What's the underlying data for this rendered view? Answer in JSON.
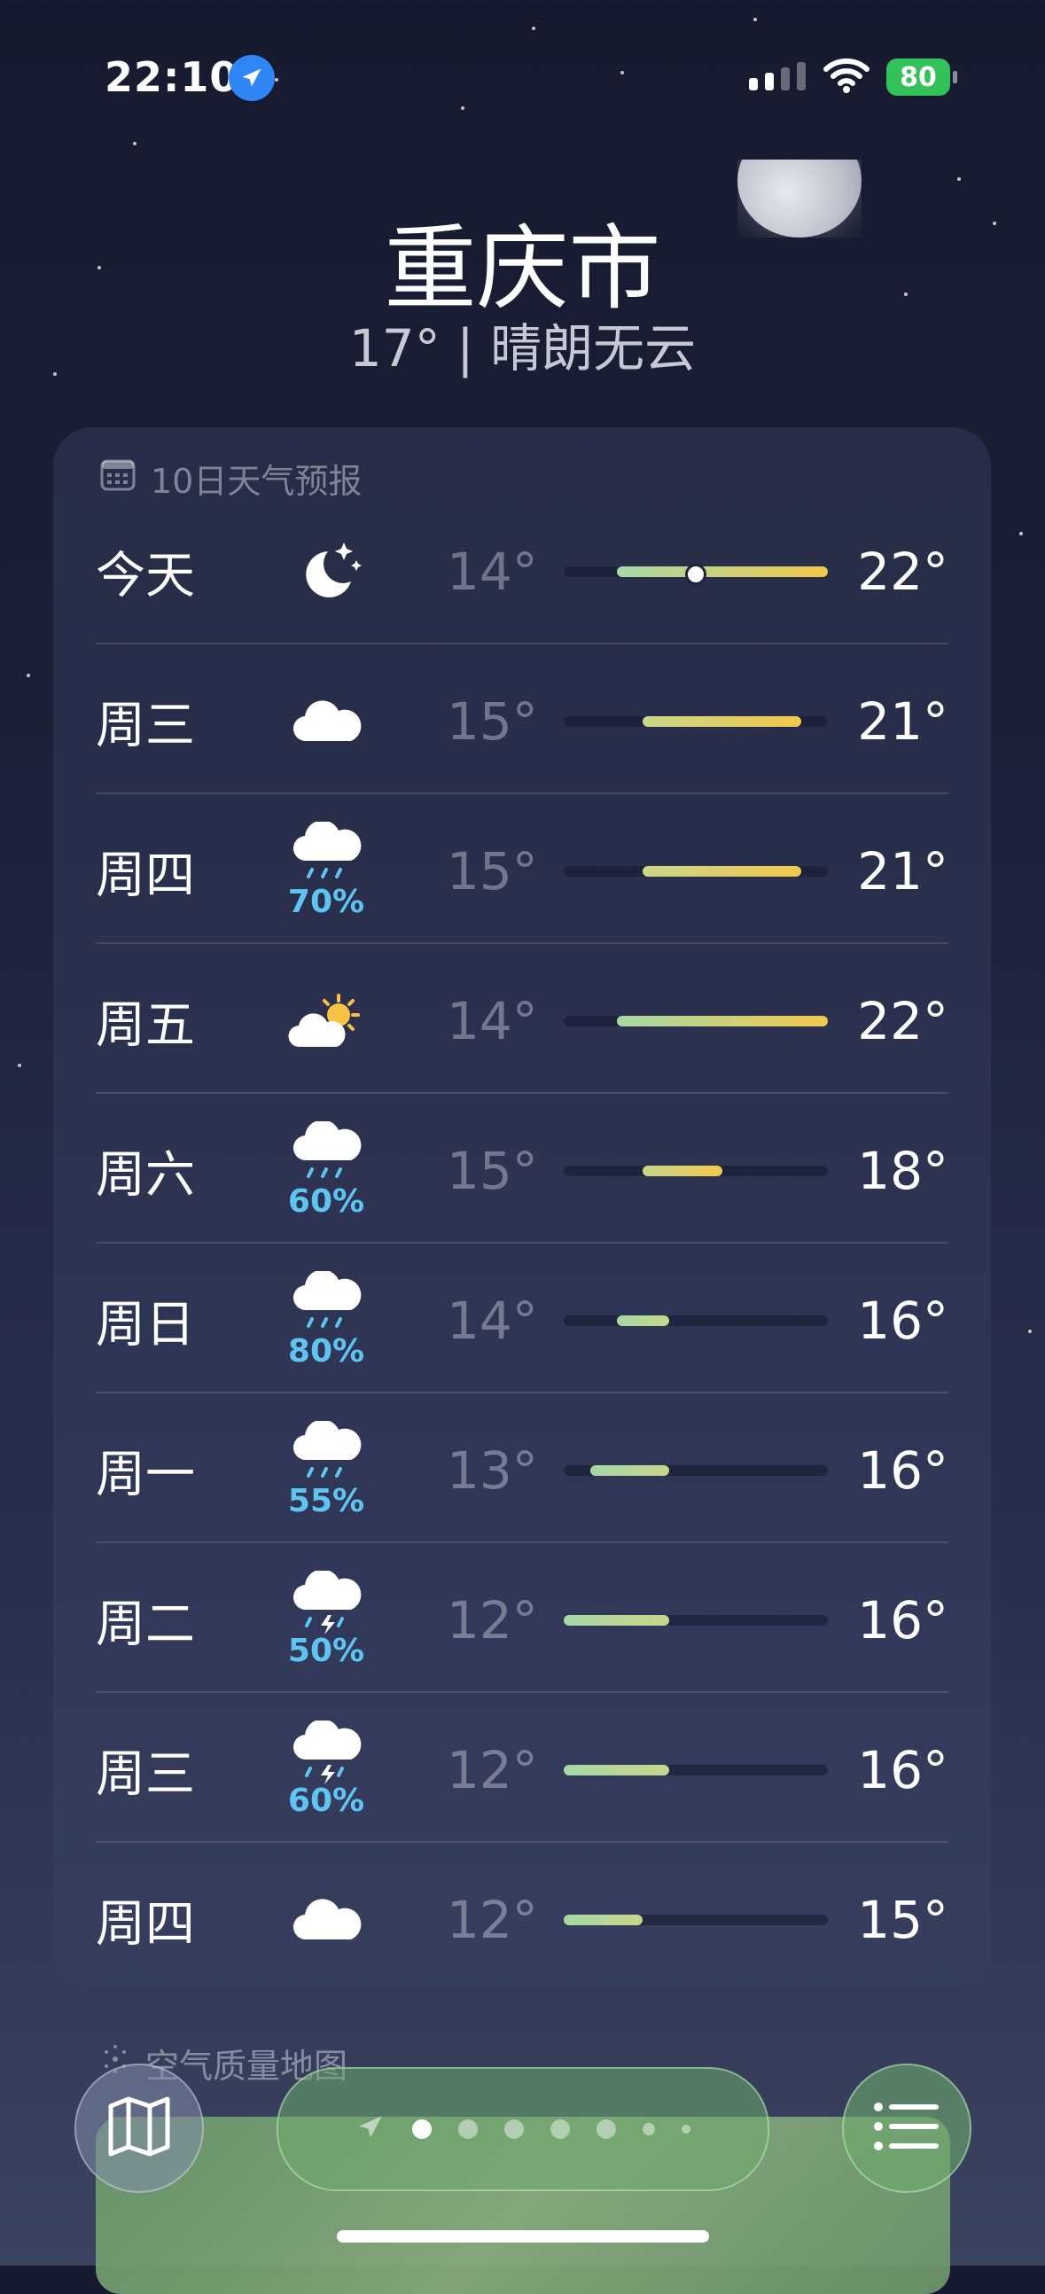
{
  "status_bar": {
    "time": "22:10",
    "battery": "80"
  },
  "location": {
    "city": "重庆市",
    "current": "17° | 晴朗无云"
  },
  "forecast": {
    "title": "10日天气预报",
    "days": [
      {
        "day": "今天",
        "icon": "moon-stars-icon",
        "precip": "",
        "low": "14°",
        "high": "22°",
        "current_marker": true
      },
      {
        "day": "周三",
        "icon": "cloud-icon",
        "precip": "",
        "low": "15°",
        "high": "21°"
      },
      {
        "day": "周四",
        "icon": "cloud-rain-icon",
        "precip": "70%",
        "low": "15°",
        "high": "21°"
      },
      {
        "day": "周五",
        "icon": "cloud-sun-icon",
        "precip": "",
        "low": "14°",
        "high": "22°"
      },
      {
        "day": "周六",
        "icon": "cloud-rain-icon",
        "precip": "60%",
        "low": "15°",
        "high": "18°"
      },
      {
        "day": "周日",
        "icon": "cloud-rain-icon",
        "precip": "80%",
        "low": "14°",
        "high": "16°"
      },
      {
        "day": "周一",
        "icon": "cloud-rain-icon",
        "precip": "55%",
        "low": "13°",
        "high": "16°"
      },
      {
        "day": "周二",
        "icon": "cloud-thunder-icon",
        "precip": "50%",
        "low": "12°",
        "high": "16°"
      },
      {
        "day": "周三",
        "icon": "cloud-thunder-icon",
        "precip": "60%",
        "low": "12°",
        "high": "16°"
      },
      {
        "day": "周四",
        "icon": "cloud-icon",
        "precip": "",
        "low": "12°",
        "high": "15°"
      }
    ],
    "range_min": 12,
    "range_max": 22,
    "current_temp": 17
  },
  "air_quality": {
    "title": "空气质量地图"
  },
  "colors": {
    "cool": "#a6d8a8",
    "mild": "#c9d68a",
    "warm": "#f2c94c",
    "precip": "#5ec5f2"
  }
}
